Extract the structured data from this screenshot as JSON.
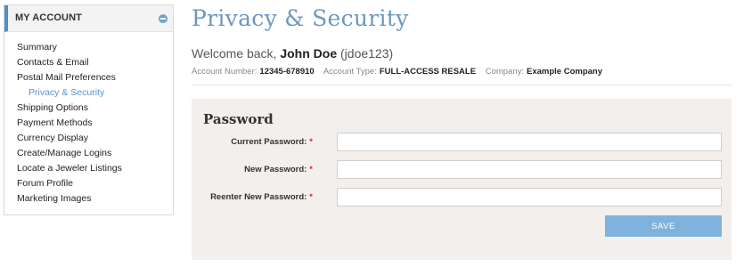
{
  "sidebar": {
    "title": "MY ACCOUNT",
    "items": [
      {
        "label": "Summary"
      },
      {
        "label": "Contacts & Email"
      },
      {
        "label": "Postal Mail Preferences"
      },
      {
        "label": "Privacy & Security",
        "active": true
      },
      {
        "label": "Shipping Options"
      },
      {
        "label": "Payment Methods"
      },
      {
        "label": "Currency Display"
      },
      {
        "label": "Create/Manage Logins"
      },
      {
        "label": "Locate a Jeweler Listings"
      },
      {
        "label": "Forum Profile"
      },
      {
        "label": "Marketing Images"
      }
    ]
  },
  "page": {
    "title": "Privacy & Security"
  },
  "welcome": {
    "prefix": "Welcome back,",
    "name": "John Doe",
    "username": "(jdoe123)"
  },
  "account": {
    "number_label": "Account Number:",
    "number": "12345-678910",
    "type_label": "Account Type:",
    "type": "FULL-ACCESS RESALE",
    "company_label": "Company:",
    "company": "Example Company"
  },
  "password_form": {
    "title": "Password",
    "fields": [
      {
        "label": "Current Password:",
        "required_mark": "*",
        "value": ""
      },
      {
        "label": "New Password:",
        "required_mark": "*",
        "value": ""
      },
      {
        "label": "Reenter New Password:",
        "required_mark": "*",
        "value": ""
      }
    ],
    "save_label": "SAVE"
  },
  "colors": {
    "accent": "#4f8fc4",
    "title": "#6d97c0",
    "active_link": "#5b93c8",
    "panel_bg": "#f2efec",
    "save_button": "#7fb3de",
    "required": "#c0392b"
  },
  "icons": {
    "collapse": "minus-circle-icon"
  }
}
